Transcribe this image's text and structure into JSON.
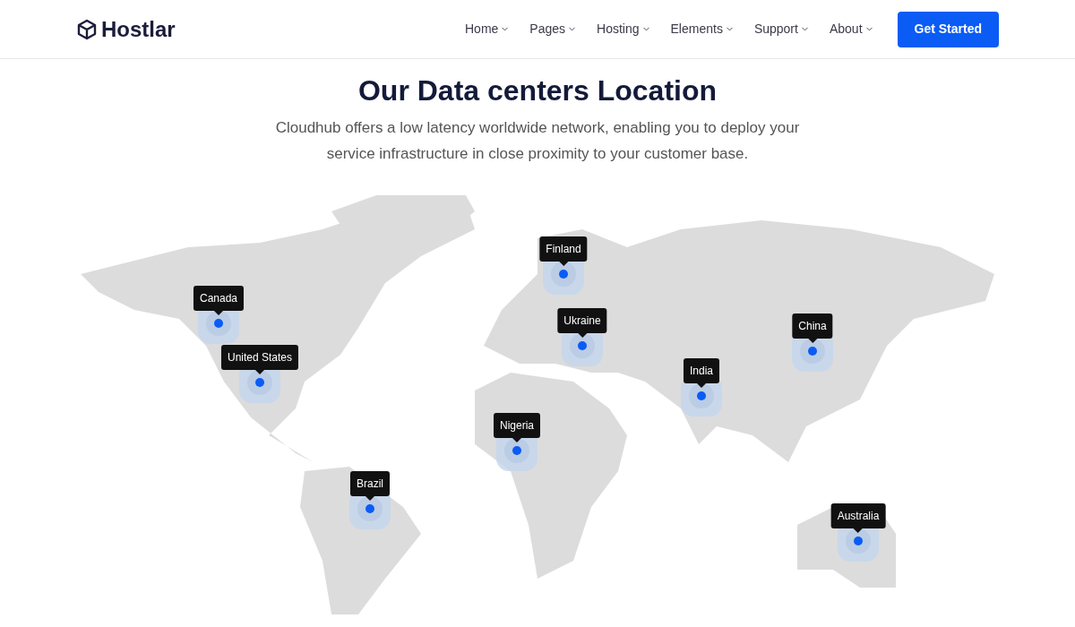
{
  "header": {
    "logo": "Hostlar",
    "nav": [
      {
        "label": "Home"
      },
      {
        "label": "Pages"
      },
      {
        "label": "Hosting"
      },
      {
        "label": "Elements"
      },
      {
        "label": "Support"
      },
      {
        "label": "About"
      }
    ],
    "cta": "Get Started"
  },
  "section": {
    "title": "Our Data centers Location",
    "subtitle": "Cloudhub offers a low latency worldwide network, enabling you to deploy your service infrastructure in close proximity to your customer base."
  },
  "locations": [
    {
      "label": "Canada"
    },
    {
      "label": "United States"
    },
    {
      "label": "Finland"
    },
    {
      "label": "Ukraine"
    },
    {
      "label": "Nigeria"
    },
    {
      "label": "Brazil"
    },
    {
      "label": "India"
    },
    {
      "label": "China"
    },
    {
      "label": "Australia"
    }
  ]
}
